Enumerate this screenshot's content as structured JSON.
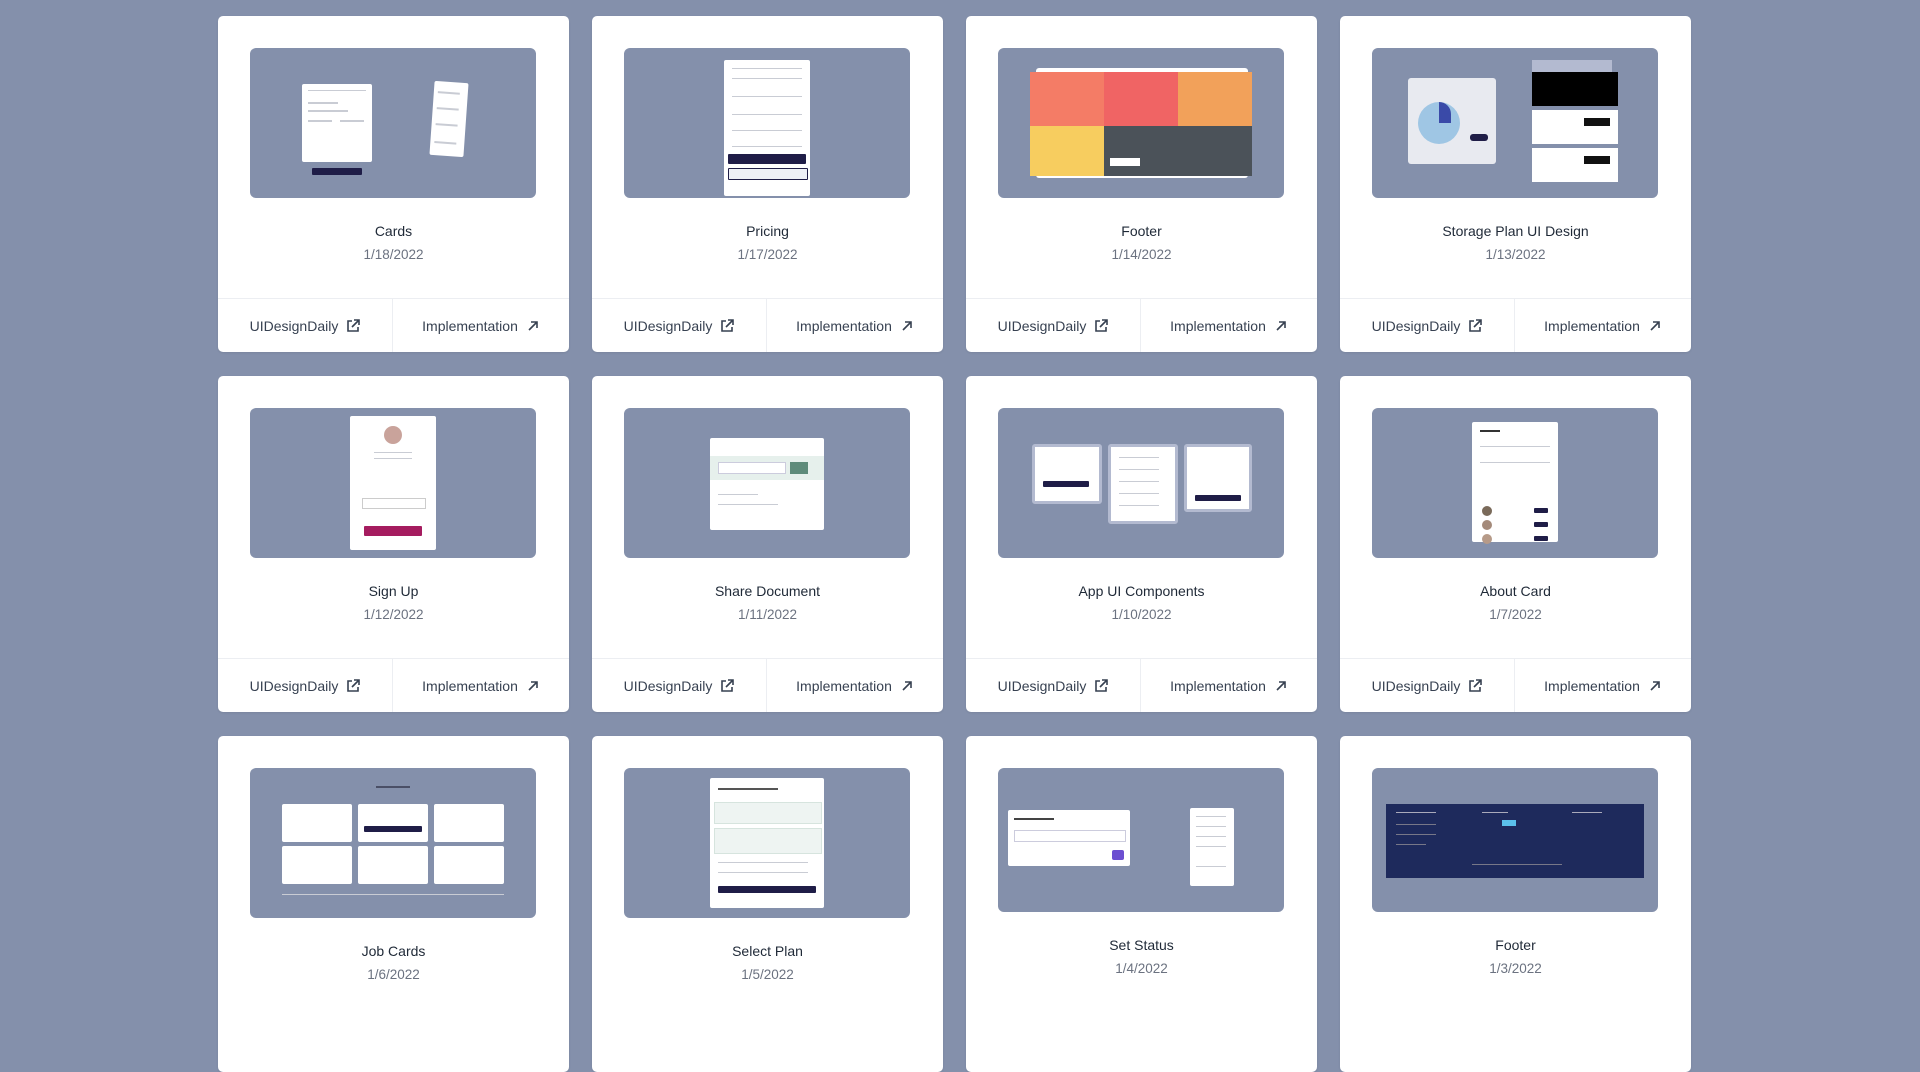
{
  "actions": {
    "source_label": "UIDesignDaily",
    "impl_label": "Implementation"
  },
  "cards": [
    {
      "title": "Cards",
      "date": "1/18/2022"
    },
    {
      "title": "Pricing",
      "date": "1/17/2022"
    },
    {
      "title": "Footer",
      "date": "1/14/2022"
    },
    {
      "title": "Storage Plan UI Design",
      "date": "1/13/2022"
    },
    {
      "title": "Sign Up",
      "date": "1/12/2022"
    },
    {
      "title": "Share Document",
      "date": "1/11/2022"
    },
    {
      "title": "App UI Components",
      "date": "1/10/2022"
    },
    {
      "title": "About Card",
      "date": "1/7/2022"
    },
    {
      "title": "Job Cards",
      "date": "1/6/2022"
    },
    {
      "title": "Select Plan",
      "date": "1/5/2022"
    },
    {
      "title": "Set Status",
      "date": "1/4/2022"
    },
    {
      "title": "Footer",
      "date": "1/3/2022"
    }
  ],
  "colors": {
    "page_bg": "#8490ab",
    "thumb_bg": "#8490ab",
    "card_bg": "#ffffff",
    "text_primary": "#1f2937",
    "text_muted": "#6b7280"
  },
  "icons": {
    "source": "external-link-icon",
    "impl": "arrow-up-right-icon"
  }
}
